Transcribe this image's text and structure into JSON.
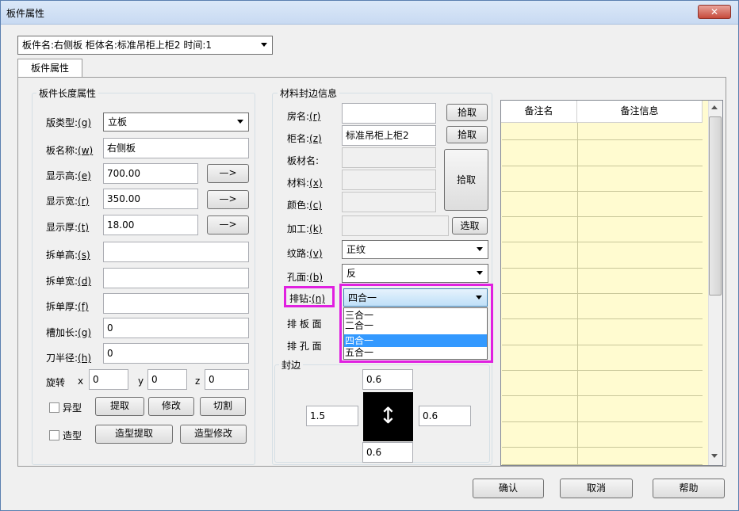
{
  "window": {
    "title": "板件属性",
    "close_label": "✕"
  },
  "selector": {
    "value": "板件名:右侧板 柜体名:标准吊柜上柜2 时间:1"
  },
  "tabs": [
    {
      "label": "板件属性"
    }
  ],
  "length_group": {
    "title": "板件长度属性",
    "board_type": {
      "label": "版类型:",
      "key": "(g)",
      "value": "立板"
    },
    "board_name": {
      "label": "板名称:",
      "key": "(w)",
      "value": "右侧板"
    },
    "display_h": {
      "label": "显示高:",
      "key": "(e)",
      "value": "700.00",
      "button": "—>"
    },
    "display_w": {
      "label": "显示宽:",
      "key": "(r)",
      "value": "350.00",
      "button": "—>"
    },
    "display_t": {
      "label": "显示厚:",
      "key": "(t)",
      "value": "18.00",
      "button": "—>"
    },
    "split_h": {
      "label": "拆单高:",
      "key": "(s)",
      "value": ""
    },
    "split_w": {
      "label": "拆单宽:",
      "key": "(d)",
      "value": ""
    },
    "split_t": {
      "label": "拆单厚:",
      "key": "(f)",
      "value": ""
    },
    "slot_add": {
      "label": "槽加长:",
      "key": "(g)",
      "value": "0"
    },
    "knife_r": {
      "label": "刀半径:",
      "key": "(h)",
      "value": "0"
    },
    "rotate": {
      "label": "旋转",
      "x_label": "x",
      "x": "0",
      "y_label": "y",
      "y": "0",
      "z_label": "z",
      "z": "0"
    },
    "shaped": {
      "label": "异型",
      "extract": "提取",
      "modify": "修改",
      "cut": "切割"
    },
    "model": {
      "label": "造型",
      "extract": "造型提取",
      "modify": "造型修改"
    }
  },
  "material_group": {
    "title": "材料封边信息",
    "room": {
      "label": "房名:",
      "key": "(r)",
      "value": "",
      "button": "拾取"
    },
    "cabinet": {
      "label": "柜名:",
      "key": "(z)",
      "value": "标准吊柜上柜2",
      "button": "拾取"
    },
    "board_material": {
      "label": "板材名:",
      "value": ""
    },
    "material": {
      "label": "材料:",
      "key": "(x)",
      "value": ""
    },
    "color": {
      "label": "颜色:",
      "key": "(c)",
      "value": ""
    },
    "pick_big": "拾取",
    "process": {
      "label": "加工:",
      "key": "(k)",
      "value": "",
      "button": "选取"
    },
    "grain": {
      "label": "纹路:",
      "key": "(v)",
      "value": "正纹"
    },
    "hole_face": {
      "label": "孔面:",
      "key": "(b)",
      "value": "反"
    },
    "drill": {
      "label": "排钻:",
      "key": "(n)",
      "value": "四合一",
      "options": [
        "三合一",
        "二合一",
        "四合一",
        "五合一"
      ],
      "selected_index": 2
    },
    "row_face": {
      "label": "排 板 面"
    },
    "row_hole": {
      "label": "排 孔 面"
    }
  },
  "edge_group": {
    "title": "封边",
    "top": "0.6",
    "left": "1.5",
    "right": "0.6",
    "bottom": "0.6",
    "arrow": "↕"
  },
  "notes": {
    "col1": "备注名",
    "col2": "备注信息"
  },
  "footer": {
    "ok": "确认",
    "cancel": "取消",
    "help": "帮助"
  },
  "colors": {
    "highlight": "#e020e0",
    "grid_fill": "#fffbd0",
    "selected": "#3399ff"
  }
}
